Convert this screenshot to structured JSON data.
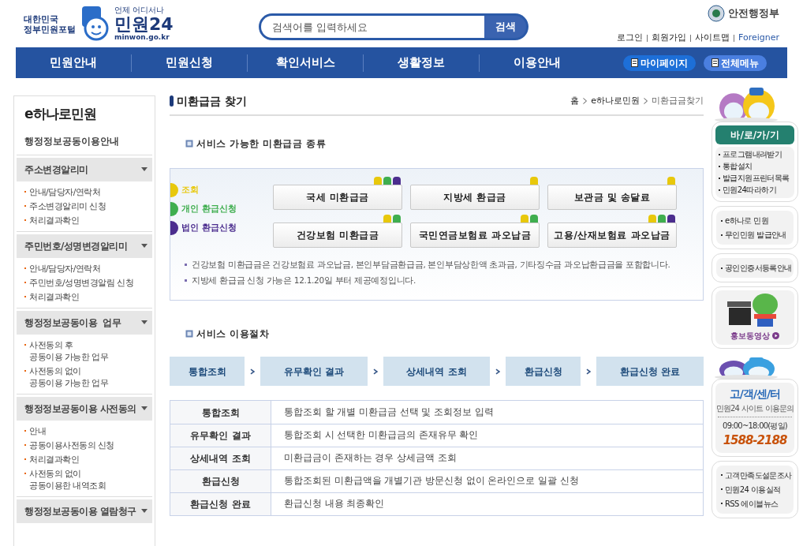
{
  "header": {
    "portal_label": "대한민국\n정부민원포털",
    "logo_tagline": "언제 어디서나",
    "logo_text": "민원24",
    "logo_url": "minwon.go.kr",
    "search": {
      "placeholder": "검색어를 입력하세요",
      "button": "검색"
    },
    "ministry": "안전행정부",
    "util_links": [
      "로그인",
      "회원가입",
      "사이트맵",
      "Foreigner"
    ]
  },
  "nav": {
    "items": [
      "민원안내",
      "민원신청",
      "확인서비스",
      "생활정보",
      "이용안내"
    ],
    "buttons": [
      "마이페이지",
      "전체메뉴"
    ]
  },
  "sidebar": {
    "title": "e하나로민원",
    "intro": "행정정보공동이용안내",
    "groups": [
      {
        "label": "주소변경알리미",
        "items": [
          "안내/담당자/연락처",
          "주소변경알리미 신청",
          "처리결과확인"
        ]
      },
      {
        "label": "주민번호/성명변경알리미",
        "items": [
          "안내/담당자/연락처",
          "주민번호/성명변경알림 신청",
          "처리결과확인"
        ]
      },
      {
        "label": "행정정보공동이용  업무",
        "items": [
          "사전동의 후\n공동이용 가능한 업무",
          "사전동의 없이\n공동이용 가능한 업무"
        ]
      },
      {
        "label": "행정정보공동이용 사전동의",
        "items": [
          "안내",
          "공동이용사전동의 신청",
          "처리결과확인",
          "사전동의 없이\n공동이용한 내역조회"
        ]
      },
      {
        "label": "행정정보공동이용 열람청구"
      }
    ]
  },
  "page": {
    "title": "미환급금 찾기",
    "breadcrumb": [
      "홈",
      "e하나로민원",
      "미환급금찾기"
    ]
  },
  "types_section": {
    "heading": "서비스 가능한 미환급금 종류",
    "legend": [
      {
        "label": "조회",
        "color": "#e8c80c"
      },
      {
        "label": "개인 환급신청",
        "color": "#3fae4f"
      },
      {
        "label": "법인 환급신청",
        "color": "#4b2d8e"
      }
    ],
    "buttons": [
      {
        "label": "국세 미환급금",
        "lookup": true,
        "personal": true,
        "corporate": true
      },
      {
        "label": "지방세 환급금",
        "lookup": true,
        "personal": false,
        "corporate": false
      },
      {
        "label": "보관금 및 송달료",
        "lookup": true,
        "personal": false,
        "corporate": false
      },
      {
        "label": "건강보험 미환급금",
        "lookup": true,
        "personal": true,
        "corporate": false
      },
      {
        "label": "국민연금보험료 과오납금",
        "lookup": true,
        "personal": true,
        "corporate": false
      },
      {
        "label": "고용/산재보험료 과오납금",
        "lookup": true,
        "personal": true,
        "corporate": true
      }
    ],
    "notes": [
      "건강보험 미환급금은 건강보험료 과오납금, 본인부담금환급금, 본인부담상한액 초과금, 기타징수금 과오납환급금을 포함합니다.",
      "지방세 환급금 신청 가능은 12.1.20일 부터 제공예정입니다."
    ]
  },
  "procedure_section": {
    "heading": "서비스 이용절차",
    "steps": [
      "통합조회",
      "유무확인 결과",
      "상세내역 조회",
      "환급신청",
      "환급신청 완료"
    ],
    "table": [
      {
        "step": "통합조회",
        "description": "통합조회 할 개별 미환급금 선택 및 조회정보 입력"
      },
      {
        "step": "유무확인 결과",
        "description": "통합조회 시 선택한 미환급금의 존재유무 확인"
      },
      {
        "step": "상세내역 조회",
        "description": "미환급금이 존재하는 경우 상세금액 조회"
      },
      {
        "step": "환급신청",
        "description": "통합조회된 미환급액을 개별기관 방문신청 없이 온라인으로 일괄 신청"
      },
      {
        "step": "환급신청 완료",
        "description": "환급신청 내용 최종확인"
      }
    ]
  },
  "right": {
    "quick_title": "바/로/가/기",
    "quick_links": [
      "프로그램내려받기",
      "통합설치",
      "발급지원프린터목록",
      "민원24따라하기"
    ],
    "links_2": [
      "e하나로 민원",
      "무인민원 발급안내"
    ],
    "links_3": [
      "공인인증서등록안내"
    ],
    "video_label": "홍보동영상",
    "center": {
      "title": "고/객/센/터",
      "subtitle": "민원24 사이트 이용문의",
      "hours": "09:00~18:00(평일)",
      "phone": "1588-2188"
    },
    "links_4": [
      "고객만족도설문조사",
      "민원24 이용실적",
      "RSS 에이블뉴스"
    ]
  }
}
